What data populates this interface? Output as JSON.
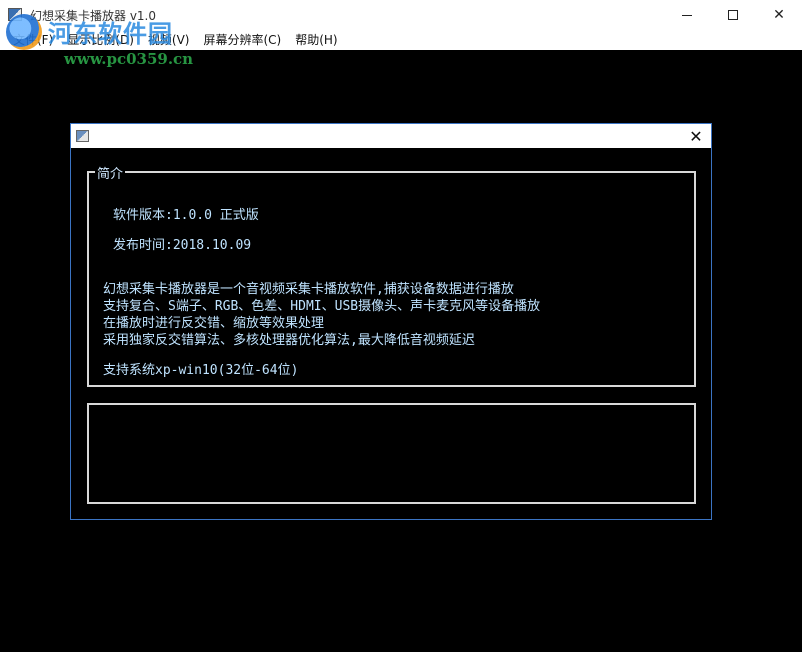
{
  "window": {
    "title": "幻想采集卡播放器 v1.0",
    "close_glyph": "✕"
  },
  "menu": {
    "items": [
      "文件(F)",
      "显示比例(D)",
      "视频(V)",
      "屏幕分辨率(C)",
      "帮助(H)"
    ]
  },
  "watermark": {
    "text": "河东软件园",
    "url": "www.pc0359.cn"
  },
  "dialog": {
    "close_glyph": "✕",
    "group_title": "简介",
    "version": "软件版本:1.0.0 正式版",
    "release": "发布时间:2018.10.09",
    "description": [
      "幻想采集卡播放器是一个音视频采集卡播放软件,捕获设备数据进行播放",
      "支持复合、S端子、RGB、色差、HDMI、USB摄像头、声卡麦克风等设备播放",
      "在播放时进行反交错、缩放等效果处理",
      "采用独家反交错算法、多核处理器优化算法,最大降低音视频延迟"
    ],
    "system": "支持系统xp-win10(32位-64位)"
  }
}
